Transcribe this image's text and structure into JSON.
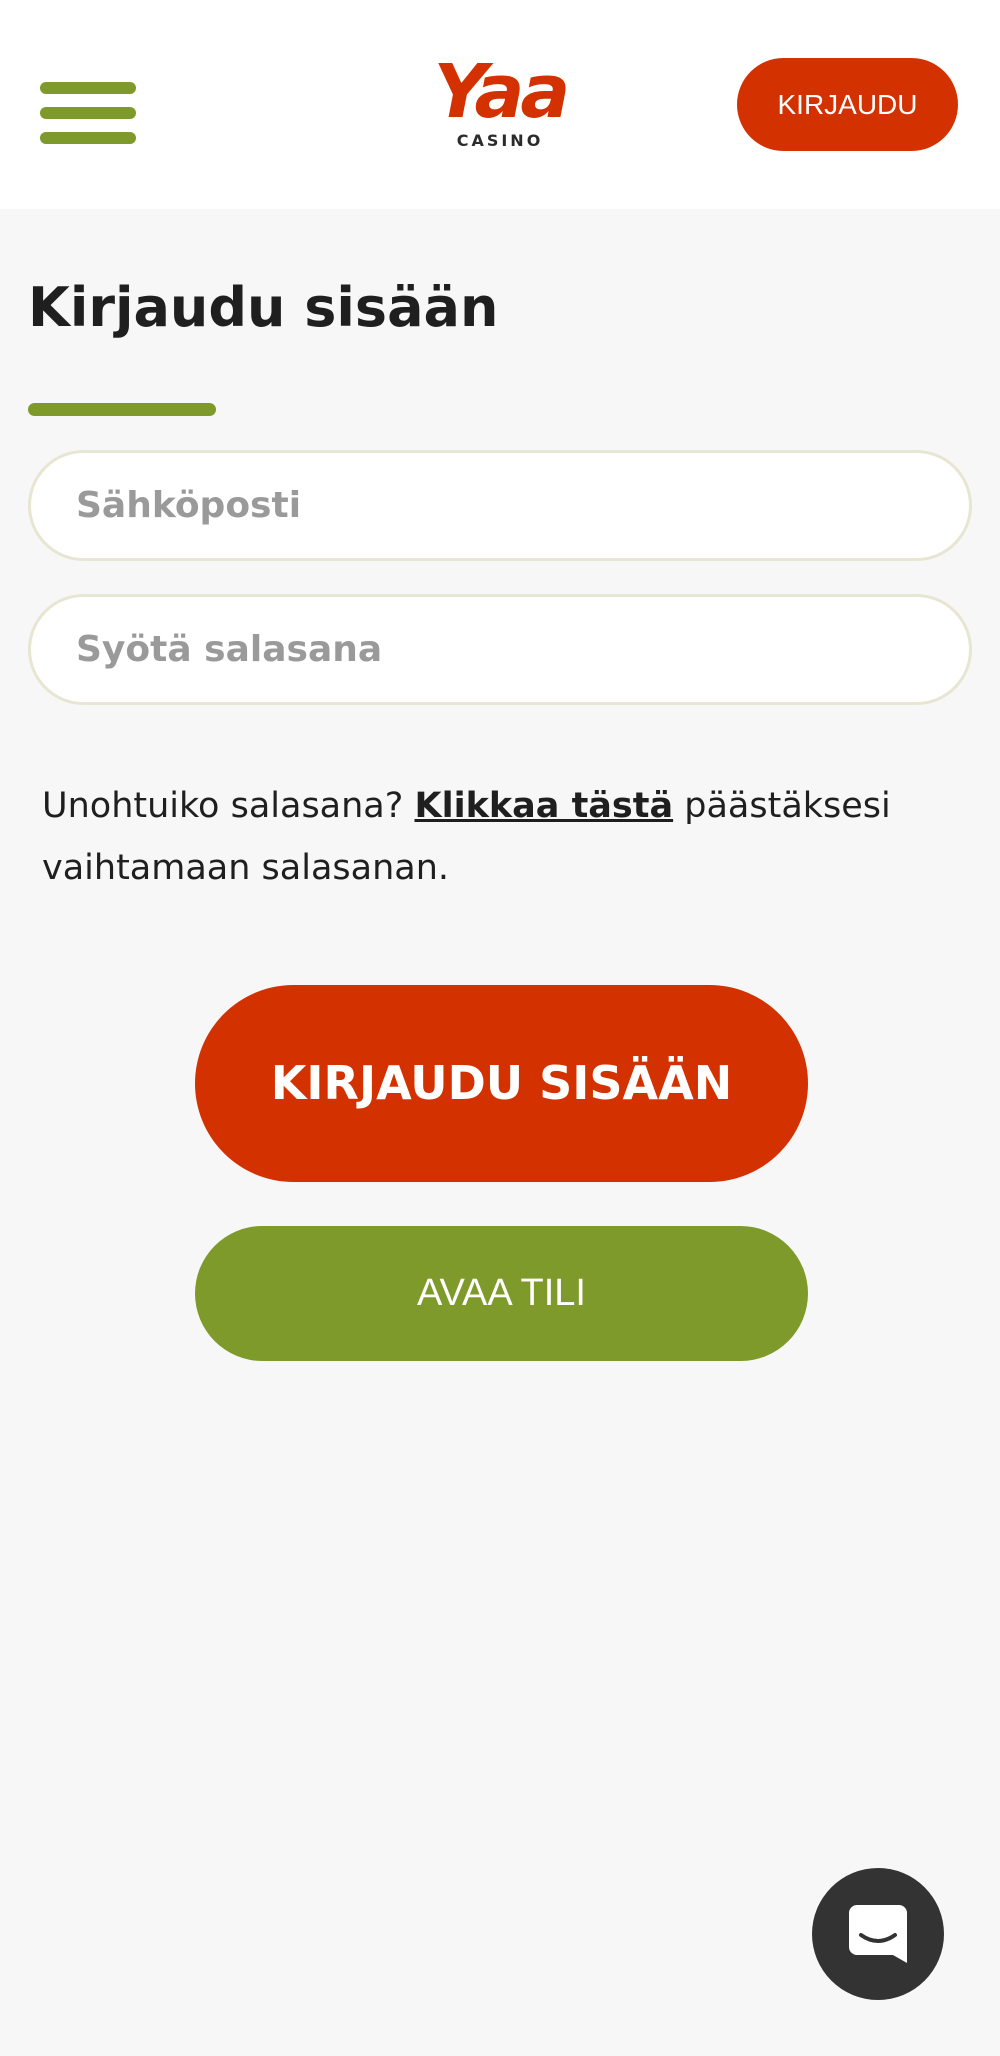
{
  "header": {
    "logo_mark": "Yaa",
    "logo_sub": "CASINO",
    "login_label": "KIRJAUDU"
  },
  "login": {
    "title": "Kirjaudu sisään",
    "email_placeholder": "Sähköposti",
    "password_placeholder": "Syötä salasana",
    "forgot_prefix": "Unohtuiko salasana?",
    "forgot_link": "Klikkaa tästä",
    "forgot_suffix": "päästäksesi vaihtamaan salasanan.",
    "submit_label": "KIRJAUDU SISÄÄN",
    "register_label": "AVAA TILI"
  },
  "icons": {
    "menu": "hamburger-menu-icon",
    "chat": "chat-bubble-icon"
  },
  "colors": {
    "primary_red": "#d43100",
    "accent_green": "#7d9a2a",
    "background": "#f7f7f7",
    "chat_button": "#333333"
  }
}
